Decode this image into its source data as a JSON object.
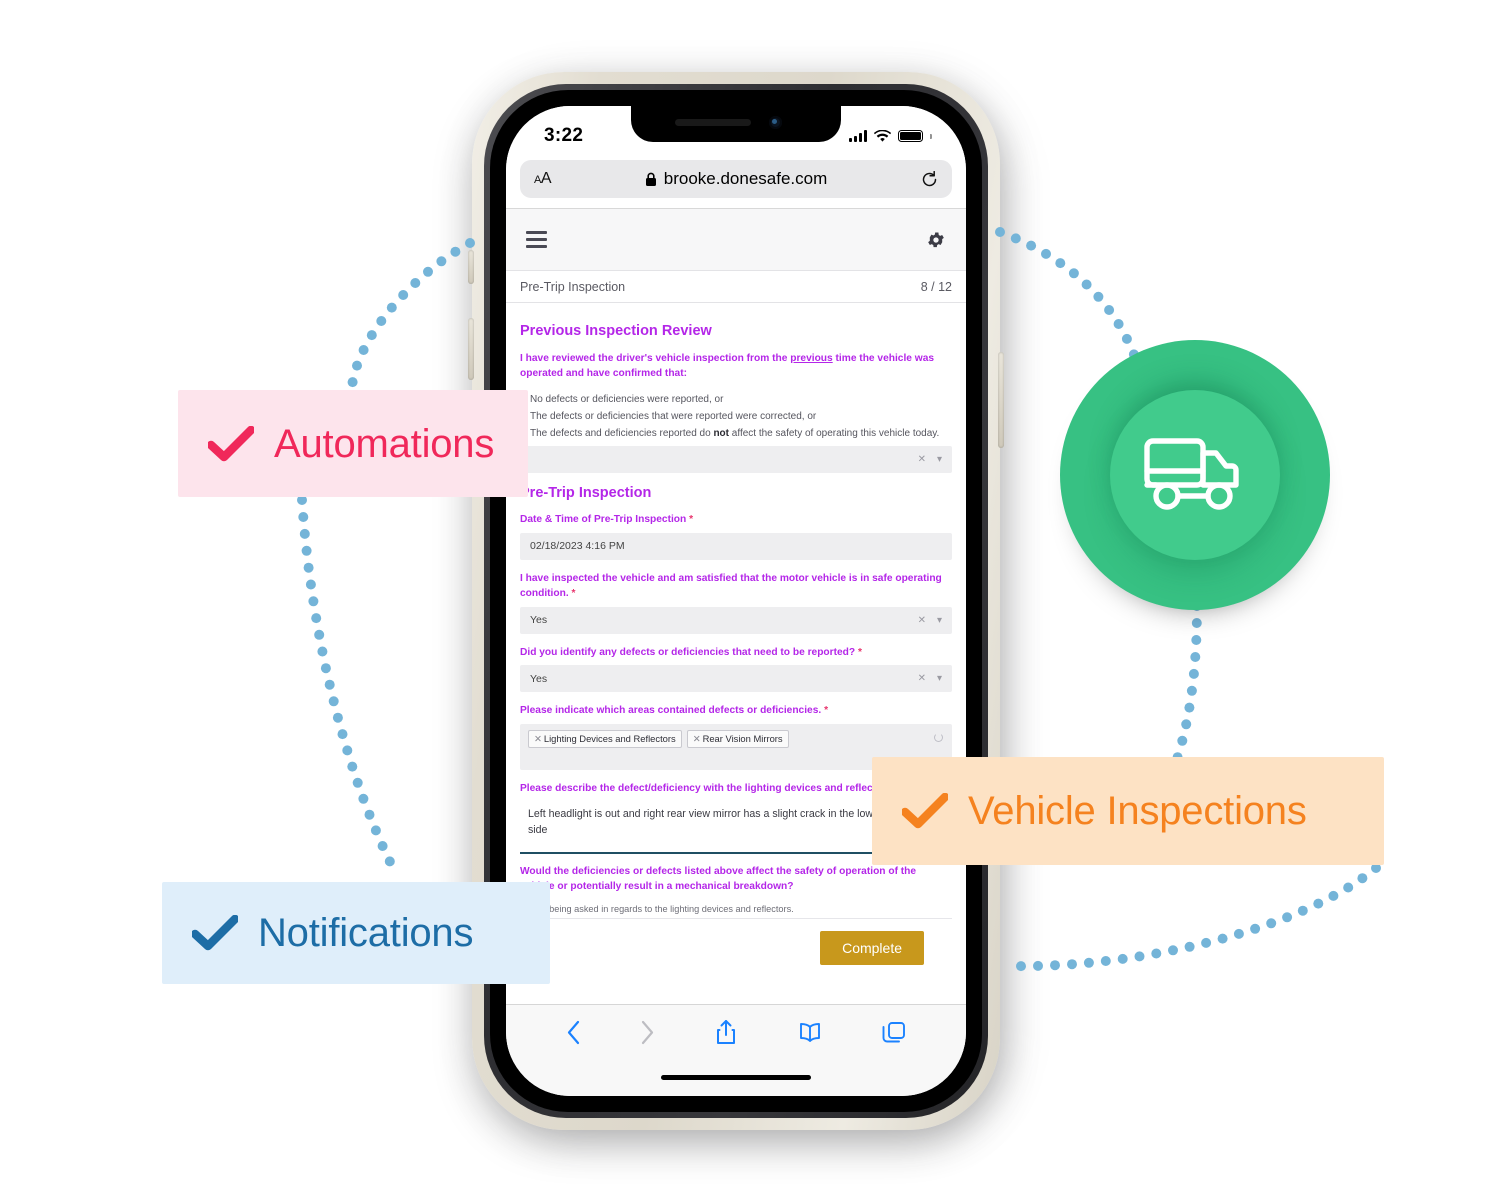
{
  "phone": {
    "status_bar": {
      "time": "3:22",
      "signal_icon": "cellular-bars-icon",
      "wifi_icon": "wifi-icon",
      "battery_icon": "battery-full-icon"
    },
    "safari": {
      "text_size_label": "AA",
      "lock_icon": "lock-icon",
      "url": "brooke.donesafe.com",
      "reload_icon": "reload-icon",
      "toolbar": {
        "back_icon": "chevron-left-icon",
        "forward_icon": "chevron-right-icon",
        "share_icon": "share-icon",
        "bookmarks_icon": "book-icon",
        "tabs_icon": "tabs-icon"
      }
    }
  },
  "app": {
    "menu_icon": "hamburger-menu-icon",
    "settings_icon": "gear-icon",
    "breadcrumb": {
      "title": "Pre-Trip Inspection",
      "progress": "8 / 12"
    },
    "sections": {
      "previous_review": {
        "heading": "Previous Inspection Review",
        "statement_a": "I have reviewed the driver's vehicle inspection from the ",
        "statement_link": "previous",
        "statement_b": " time the vehicle was operated and have confirmed that:",
        "bullets": [
          "No defects or deficiencies were reported, or",
          "The defects or deficiencies that were reported were corrected, or",
          "The defects and deficiencies reported do not affect the safety of operating this vehicle today."
        ],
        "select_value": "",
        "clear_icon": "clear-x-icon",
        "caret_icon": "chevron-down-icon"
      },
      "pre_trip": {
        "heading": "Pre-Trip Inspection",
        "datetime_label": "Date & Time of Pre-Trip Inspection",
        "datetime_value": "02/18/2023 4:16 PM",
        "safe_operating_label": "I have inspected the vehicle and am satisfied that the motor vehicle is in safe operating condition.",
        "safe_operating_value": "Yes",
        "defects_label": "Did you identify any defects or deficiencies that need to be reported?",
        "defects_value": "Yes",
        "areas_label": "Please indicate which areas contained defects or deficiencies.",
        "areas_tags": [
          "Lighting Devices and Reflectors",
          "Rear Vision Mirrors"
        ],
        "describe_label": "Please describe the defect/deficiency with the lighting devices and reflectors.",
        "describe_value": "Left headlight is out and right rear view mirror has a slight crack in the lower left hand side",
        "safety_label": "Would the deficiencies or defects listed above affect the safety of operation of the vehicle or potentially result in a mechanical breakdown?",
        "safety_hint": "This is being asked in regards to the lighting devices and reflectors.",
        "required_marker": "*"
      }
    },
    "complete_button": "Complete",
    "chat_icon": "intercom-chat-icon"
  },
  "badges": [
    {
      "key": "automations",
      "label": "Automations",
      "icon": "check-icon",
      "color": "#f0285a",
      "background": "#fde4ec"
    },
    {
      "key": "notifications",
      "label": "Notifications",
      "icon": "check-icon",
      "color": "#1d6da6",
      "background": "#dfeefa"
    },
    {
      "key": "vehicle_inspections",
      "label": "Vehicle Inspections",
      "icon": "check-icon",
      "color": "#f5821f",
      "background": "#fde2c4"
    }
  ],
  "feature_circle": {
    "icon": "delivery-truck-icon",
    "color": "#37c183",
    "inner_color": "#41cb8c"
  },
  "connectors": {
    "color": "#74b4d8",
    "style": "dotted"
  }
}
